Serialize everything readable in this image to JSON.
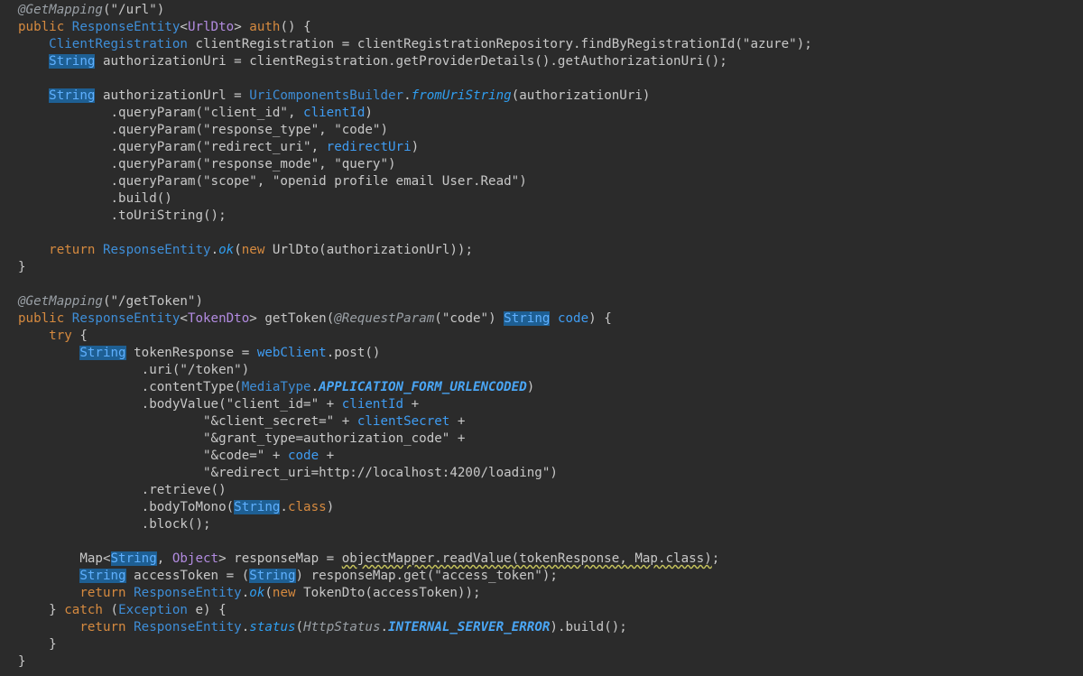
{
  "editor": {
    "theme": {
      "background": "#2b2b2b",
      "keyword": "#d68a3f",
      "type": "#3e8ed8",
      "generic": "#b28be0",
      "highlight": "#1e5f93"
    },
    "lines": [
      [
        [
          "ann",
          "@GetMapping"
        ],
        [
          "plain",
          "(\"/url\")"
        ]
      ],
      [
        [
          "kw",
          "public "
        ],
        [
          "type",
          "ResponseEntity"
        ],
        [
          "plain",
          "<"
        ],
        [
          "generic",
          "UrlDto"
        ],
        [
          "plain",
          "> "
        ],
        [
          "kw",
          "auth"
        ],
        [
          "plain",
          "() {"
        ]
      ],
      [
        [
          "plain",
          "    "
        ],
        [
          "type",
          "ClientRegistration"
        ],
        [
          "plain",
          " clientRegistration = clientRegistrationRepository.findByRegistrationId(\"azure\");"
        ]
      ],
      [
        [
          "plain",
          "    "
        ],
        [
          "hl",
          "String"
        ],
        [
          "plain",
          " authorizationUri = clientRegistration.getProviderDetails().getAuthorizationUri();"
        ]
      ],
      [],
      [
        [
          "plain",
          "    "
        ],
        [
          "hl",
          "String"
        ],
        [
          "plain",
          " authorizationUrl = "
        ],
        [
          "type",
          "UriComponentsBuilder"
        ],
        [
          "plain",
          "."
        ],
        [
          "ital",
          "fromUriString"
        ],
        [
          "plain",
          "(authorizationUri)"
        ]
      ],
      [
        [
          "plain",
          "            .queryParam(\"client_id\", "
        ],
        [
          "var",
          "clientId"
        ],
        [
          "plain",
          ")"
        ]
      ],
      [
        [
          "plain",
          "            .queryParam(\"response_type\", \"code\")"
        ]
      ],
      [
        [
          "plain",
          "            .queryParam(\"redirect_uri\", "
        ],
        [
          "var",
          "redirectUri"
        ],
        [
          "plain",
          ")"
        ]
      ],
      [
        [
          "plain",
          "            .queryParam(\"response_mode\", \"query\")"
        ]
      ],
      [
        [
          "plain",
          "            .queryParam(\"scope\", \"openid profile email User.Read\")"
        ]
      ],
      [
        [
          "plain",
          "            .build()"
        ]
      ],
      [
        [
          "plain",
          "            .toUriString();"
        ]
      ],
      [],
      [
        [
          "plain",
          "    "
        ],
        [
          "kw",
          "return "
        ],
        [
          "type",
          "ResponseEntity"
        ],
        [
          "plain",
          "."
        ],
        [
          "ital",
          "ok"
        ],
        [
          "plain",
          "("
        ],
        [
          "kw",
          "new "
        ],
        [
          "plain",
          "UrlDto(authorizationUrl));"
        ]
      ],
      [
        [
          "plain",
          "}"
        ]
      ],
      [],
      [
        [
          "ann",
          "@GetMapping"
        ],
        [
          "plain",
          "(\"/getToken\")"
        ]
      ],
      [
        [
          "kw",
          "public "
        ],
        [
          "type",
          "ResponseEntity"
        ],
        [
          "plain",
          "<"
        ],
        [
          "generic",
          "TokenDto"
        ],
        [
          "plain",
          "> getToken("
        ],
        [
          "ann",
          "@RequestParam"
        ],
        [
          "plain",
          "(\"code\") "
        ],
        [
          "hl",
          "String"
        ],
        [
          "plain",
          " "
        ],
        [
          "var",
          "code"
        ],
        [
          "plain",
          ") {"
        ]
      ],
      [
        [
          "plain",
          "    "
        ],
        [
          "kw",
          "try"
        ],
        [
          "plain",
          " {"
        ]
      ],
      [
        [
          "plain",
          "        "
        ],
        [
          "hl",
          "String"
        ],
        [
          "plain",
          " tokenResponse = "
        ],
        [
          "var",
          "webClient"
        ],
        [
          "plain",
          ".post()"
        ]
      ],
      [
        [
          "plain",
          "                .uri(\"/token\")"
        ]
      ],
      [
        [
          "plain",
          "                .contentType("
        ],
        [
          "type",
          "MediaType"
        ],
        [
          "plain",
          "."
        ],
        [
          "const",
          "APPLICATION_FORM_URLENCODED"
        ],
        [
          "plain",
          ")"
        ]
      ],
      [
        [
          "plain",
          "                .bodyValue(\"client_id=\" + "
        ],
        [
          "var",
          "clientId"
        ],
        [
          "plain",
          " +"
        ]
      ],
      [
        [
          "plain",
          "                        \"&client_secret=\" + "
        ],
        [
          "var",
          "clientSecret"
        ],
        [
          "plain",
          " +"
        ]
      ],
      [
        [
          "plain",
          "                        \"&grant_type=authorization_code\" +"
        ]
      ],
      [
        [
          "plain",
          "                        \"&code=\" + "
        ],
        [
          "var",
          "code"
        ],
        [
          "plain",
          " +"
        ]
      ],
      [
        [
          "plain",
          "                        \"&redirect_uri=http://localhost:4200/loading\")"
        ]
      ],
      [
        [
          "plain",
          "                .retrieve()"
        ]
      ],
      [
        [
          "plain",
          "                .bodyToMono("
        ],
        [
          "hl",
          "String"
        ],
        [
          "plain",
          "."
        ],
        [
          "kw",
          "class"
        ],
        [
          "plain",
          ")"
        ]
      ],
      [
        [
          "plain",
          "                .block();"
        ]
      ],
      [],
      [
        [
          "plain",
          "        Map<"
        ],
        [
          "hl",
          "String"
        ],
        [
          "plain",
          ", "
        ],
        [
          "generic",
          "Object"
        ],
        [
          "plain",
          "> responseMap = "
        ],
        [
          "warn",
          "objectMapper.readValue(tokenResponse, Map.class)"
        ],
        [
          "plain",
          ";"
        ]
      ],
      [
        [
          "plain",
          "        "
        ],
        [
          "hl",
          "String"
        ],
        [
          "plain",
          " accessToken = ("
        ],
        [
          "hl",
          "String"
        ],
        [
          "plain",
          ") responseMap.get(\"access_token\");"
        ]
      ],
      [
        [
          "plain",
          "        "
        ],
        [
          "kw",
          "return "
        ],
        [
          "type",
          "ResponseEntity"
        ],
        [
          "plain",
          "."
        ],
        [
          "ital",
          "ok"
        ],
        [
          "plain",
          "("
        ],
        [
          "kw",
          "new "
        ],
        [
          "plain",
          "TokenDto(accessToken));"
        ]
      ],
      [
        [
          "plain",
          "    } "
        ],
        [
          "kw",
          "catch"
        ],
        [
          "plain",
          " ("
        ],
        [
          "type",
          "Exception"
        ],
        [
          "plain",
          " e) {"
        ]
      ],
      [
        [
          "plain",
          "        "
        ],
        [
          "kw",
          "return "
        ],
        [
          "type",
          "ResponseEntity"
        ],
        [
          "plain",
          "."
        ],
        [
          "ital",
          "status"
        ],
        [
          "plain",
          "("
        ],
        [
          "ann",
          "HttpStatus"
        ],
        [
          "plain",
          "."
        ],
        [
          "const",
          "INTERNAL_SERVER_ERROR"
        ],
        [
          "plain",
          ").build();"
        ]
      ],
      [
        [
          "plain",
          "    }"
        ]
      ],
      [
        [
          "plain",
          "}"
        ]
      ]
    ]
  }
}
